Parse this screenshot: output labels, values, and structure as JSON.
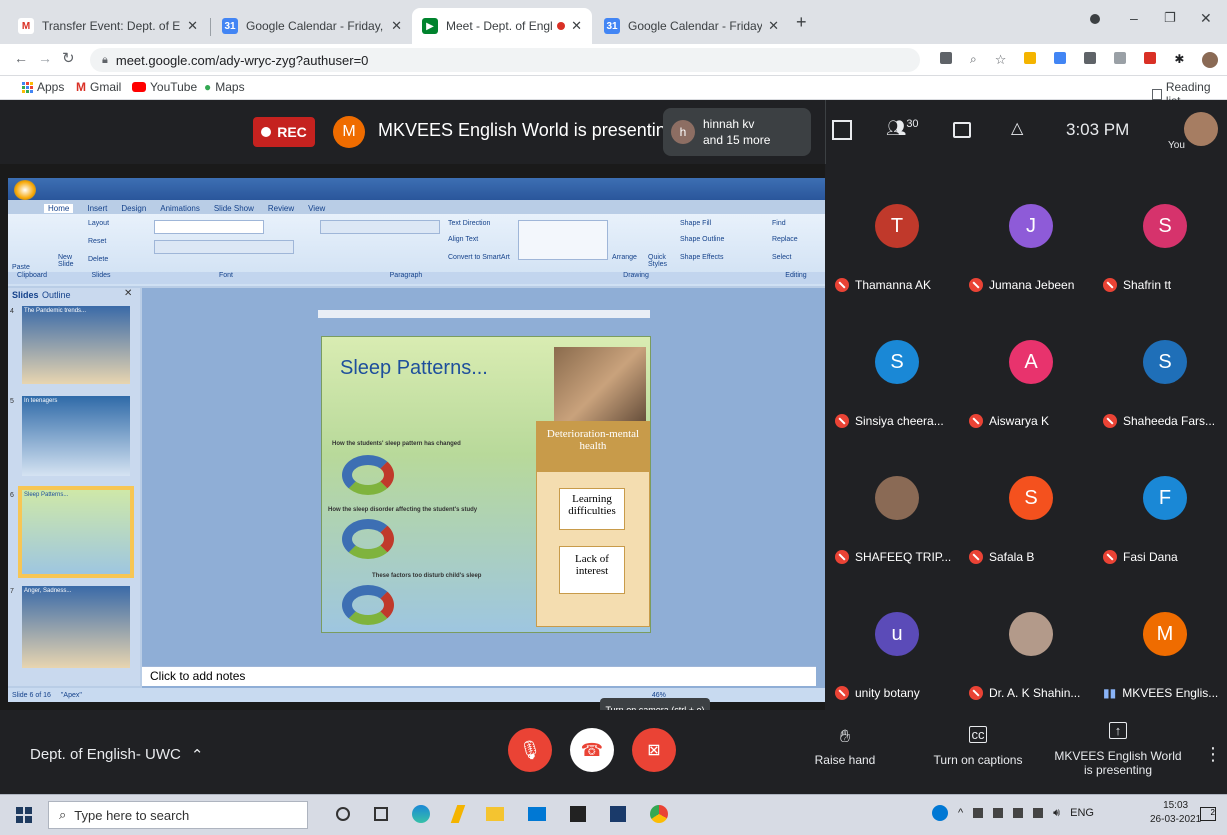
{
  "browser": {
    "tabs": [
      {
        "title": "Transfer Event: Dept. of English- I",
        "favicon": "gmail-icon"
      },
      {
        "title": "Google Calendar - Friday, March",
        "favicon": "calendar-icon"
      },
      {
        "title": "Meet - Dept. of English- UW",
        "favicon": "meet-icon"
      },
      {
        "title": "Google Calendar - Friday, March",
        "favicon": "calendar-icon"
      }
    ],
    "url": "meet.google.com/ady-wryc-zyg?authuser=0",
    "bookmarks": [
      "Apps",
      "Gmail",
      "YouTube",
      "Maps"
    ],
    "reading_list": "Reading list"
  },
  "meet_top": {
    "rec_label": "REC",
    "presenter_initial": "M",
    "presenting_text": "MKVEES English World is presenting",
    "participant_initial": "h",
    "participant_line1": "hinnah kv",
    "participant_line2": "and 15 more",
    "participant_count": "30",
    "time": "3:03 PM",
    "self_label": "You"
  },
  "ppt": {
    "ribbon_tabs": [
      "Home",
      "Insert",
      "Design",
      "Animations",
      "Slide Show",
      "Review",
      "View"
    ],
    "ribbon_groups": [
      "Clipboard",
      "Slides",
      "Font",
      "Paragraph",
      "Drawing",
      "Editing"
    ],
    "ribbon_items": {
      "layout": "Layout",
      "reset": "Reset",
      "delete": "Delete",
      "paste": "Paste",
      "new_slide": "New Slide",
      "text_direction": "Text Direction",
      "align_text": "Align Text",
      "convert": "Convert to SmartArt",
      "arrange": "Arrange",
      "quick_styles": "Quick Styles",
      "shape_fill": "Shape Fill",
      "shape_outline": "Shape Outline",
      "shape_effects": "Shape Effects",
      "find": "Find",
      "replace": "Replace",
      "select": "Select"
    },
    "panel_tabs": [
      "Slides",
      "Outline"
    ],
    "thumb_numbers": [
      "4",
      "5",
      "6",
      "7"
    ],
    "thumb_titles": [
      "The Pandemic trends...",
      "In teenagers",
      "Sleep Patterns...",
      "Anger, Sadness..."
    ],
    "slide_title": "Sleep Patterns...",
    "slide_box1": "Deterioration-mental health",
    "slide_box2": "Learning difficulties",
    "slide_box3": "Lack of interest",
    "slide_heading1": "How the students' sleep pattern has changed",
    "slide_heading2": "How the sleep disorder affecting the student's study",
    "slide_heading3": "These factors too disturb child's sleep",
    "notes_placeholder": "Click to add notes",
    "status_slide": "Slide 6 of 16",
    "status_theme": "\"Apex\"",
    "zoom": "46%"
  },
  "participants": [
    {
      "name": "Thamanna AK",
      "initial": "T",
      "color": "#c0392b",
      "muted": true
    },
    {
      "name": "Jumana Jebeen",
      "initial": "J",
      "color": "#8e5bd8",
      "muted": true
    },
    {
      "name": "Shafrin tt",
      "initial": "S",
      "color": "#d6336c",
      "muted": true
    },
    {
      "name": "Sinsiya cheera...",
      "initial": "S",
      "color": "#1a88d6",
      "muted": true
    },
    {
      "name": "Aiswarya K",
      "initial": "A",
      "color": "#e8336d",
      "muted": true
    },
    {
      "name": "Shaheeda Fars...",
      "initial": "S",
      "color": "#1f6fb8",
      "muted": true
    },
    {
      "name": "SHAFEEQ TRIP...",
      "initial": "",
      "color": "#8a6a55",
      "muted": true
    },
    {
      "name": "Safala B",
      "initial": "S",
      "color": "#f4511e",
      "muted": true
    },
    {
      "name": "Fasi Dana",
      "initial": "F",
      "color": "#1a88d6",
      "muted": true
    },
    {
      "name": "unity botany",
      "initial": "u",
      "color": "#5b4bb8",
      "muted": true
    },
    {
      "name": "Dr. A. K Shahin...",
      "initial": "",
      "color": "#b39a8a",
      "muted": true
    },
    {
      "name": "MKVEES Englis...",
      "initial": "M",
      "color": "#ef6c00",
      "muted": false
    }
  ],
  "controls": {
    "meeting_name": "Dept. of English- UWC",
    "camera_tooltip": "Turn on camera (ctrl + e)",
    "raise_hand": "Raise hand",
    "captions": "Turn on captions",
    "presenting_line1": "MKVEES English World",
    "presenting_line2": "is presenting"
  },
  "taskbar": {
    "search_placeholder": "Type here to search",
    "lang": "ENG",
    "time": "15:03",
    "date": "26-03-2021",
    "notif_count": "2"
  }
}
